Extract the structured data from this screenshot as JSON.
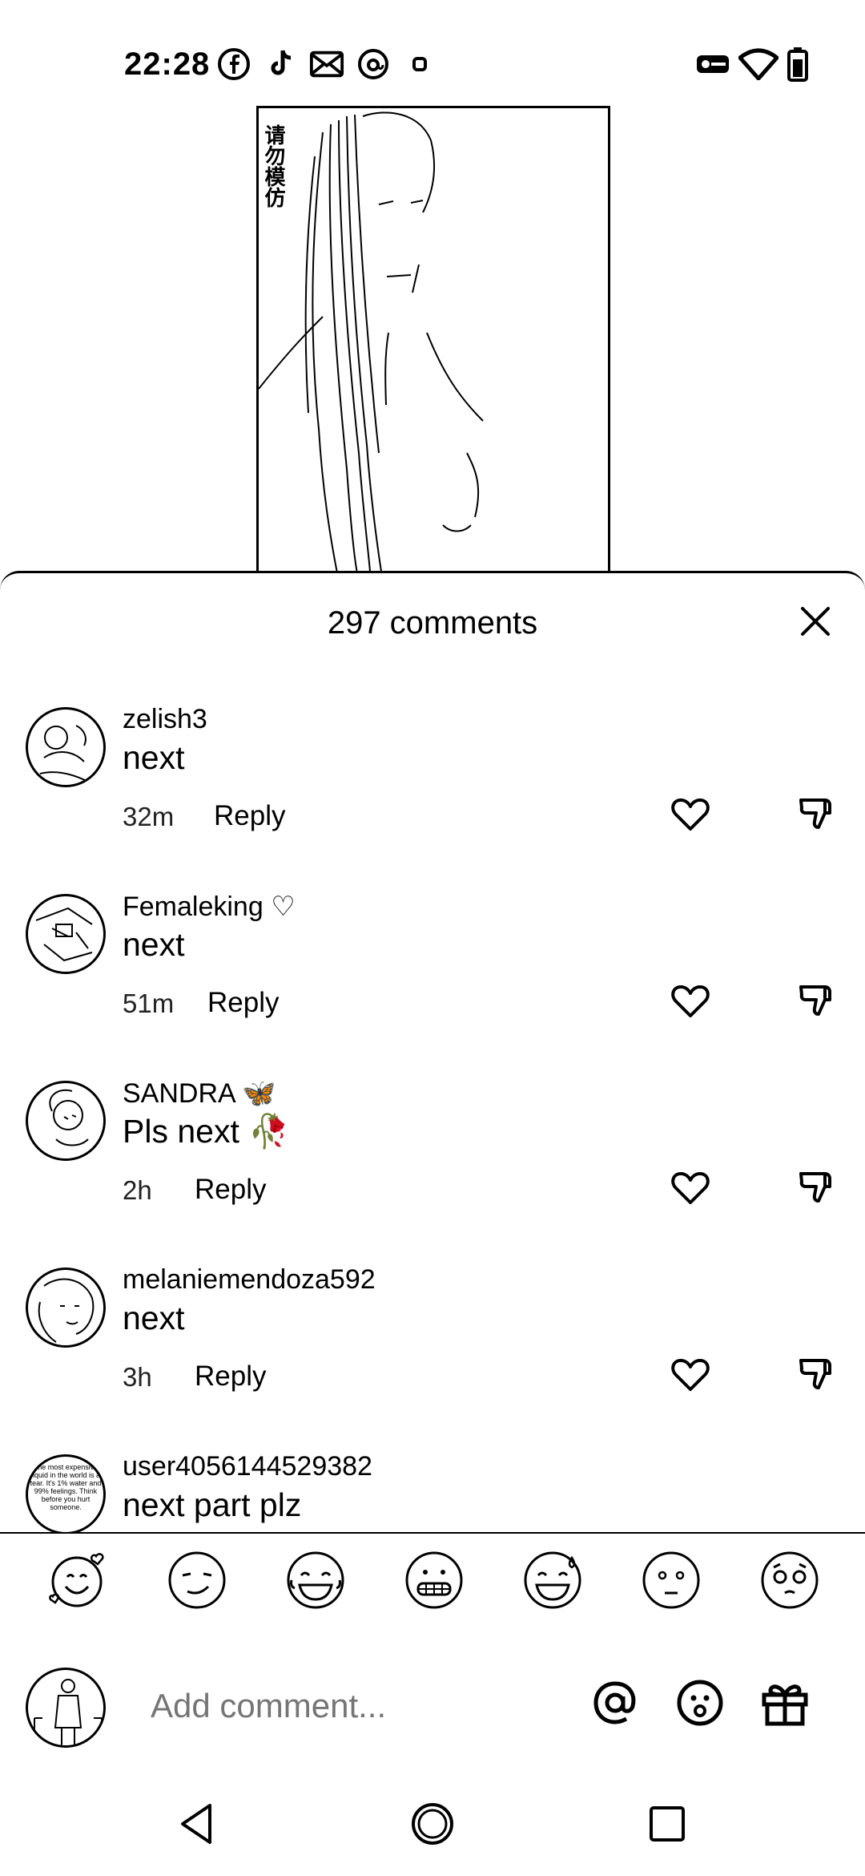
{
  "status": {
    "time": "22:28",
    "left_icons": [
      "facebook-icon",
      "tiktok-icon",
      "mail-icon",
      "threads-icon",
      "dot-icon"
    ],
    "right_icons": [
      "vpn-key-icon",
      "wifi-icon",
      "battery-icon"
    ]
  },
  "video": {
    "watermark": "请勿模仿"
  },
  "sheet": {
    "title": "297 comments"
  },
  "comments": [
    {
      "user": "zelish3",
      "text": "next",
      "time": "32m",
      "reply": "Reply"
    },
    {
      "user": "Femaleking ♡",
      "text": "next",
      "time": "51m",
      "reply": "Reply"
    },
    {
      "user": "SANDRA 🦋",
      "text": "Pls next 🥀",
      "time": "2h",
      "reply": "Reply"
    },
    {
      "user": "melaniemendoza592",
      "text": "next",
      "time": "3h",
      "reply": "Reply"
    },
    {
      "user": "user4056144529382",
      "text": "next part plz",
      "time": "",
      "reply": ""
    }
  ],
  "avatar_text_5": "The most expensive liquid in the world is a tear. It's 1% water and 99% feelings. Think before you hurt someone.",
  "emojis": [
    "smiling-hearts-icon",
    "smirk-icon",
    "joy-icon",
    "grimace-icon",
    "sweat-smile-icon",
    "flushed-icon",
    "pleading-icon"
  ],
  "input": {
    "placeholder": "Add comment..."
  }
}
